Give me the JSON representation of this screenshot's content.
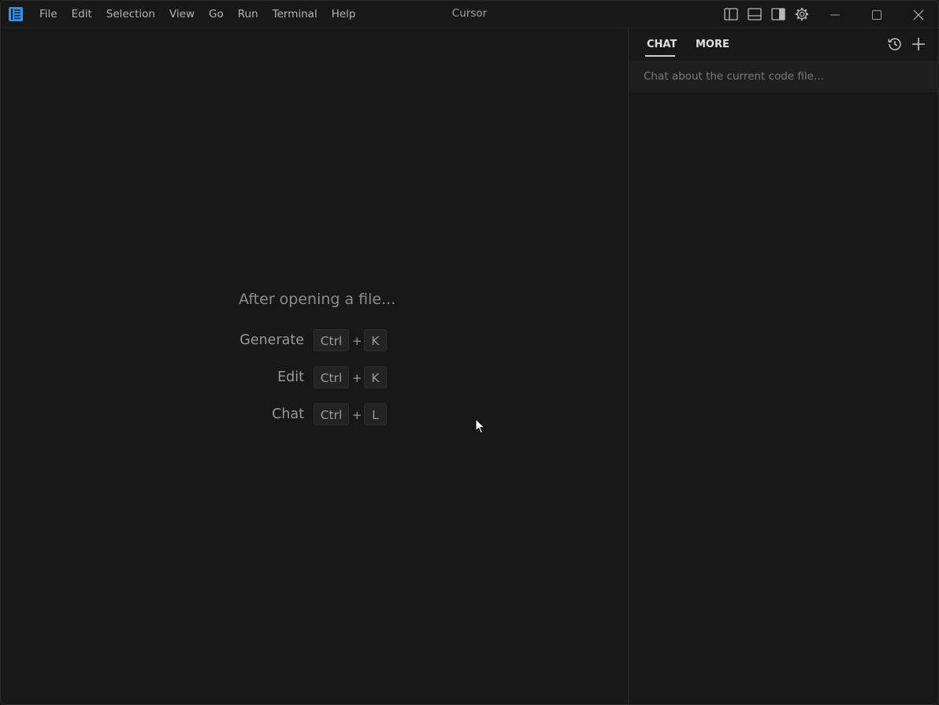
{
  "window": {
    "title": "Cursor"
  },
  "menu": {
    "items": [
      "File",
      "Edit",
      "Selection",
      "View",
      "Go",
      "Run",
      "Terminal",
      "Help"
    ]
  },
  "titlebar_icons": {
    "logo": "cursor-logo-icon",
    "layout": [
      "toggle-primary-sidebar-icon",
      "toggle-panel-icon",
      "toggle-secondary-sidebar-icon",
      "gear-icon"
    ],
    "window_controls": [
      "minimize-icon",
      "maximize-icon",
      "close-icon"
    ]
  },
  "editor": {
    "heading": "After opening a file...",
    "shortcuts": [
      {
        "label": "Generate",
        "modifier": "Ctrl",
        "plus": "+",
        "key": "K"
      },
      {
        "label": "Edit",
        "modifier": "Ctrl",
        "plus": "+",
        "key": "K"
      },
      {
        "label": "Chat",
        "modifier": "Ctrl",
        "plus": "+",
        "key": "L"
      }
    ]
  },
  "chat_panel": {
    "tabs": [
      {
        "label": "CHAT",
        "active": true
      },
      {
        "label": "MORE",
        "active": false
      }
    ],
    "icons": [
      "history-icon",
      "plus-icon"
    ],
    "input": {
      "placeholder": "Chat about the current code file...",
      "value": ""
    }
  },
  "colors": {
    "background": "#181818",
    "border": "#2b2b2b",
    "logo_accent": "#3a8ee6",
    "text_muted": "#9a9a9a",
    "tab_active": "#e0e0e0"
  }
}
